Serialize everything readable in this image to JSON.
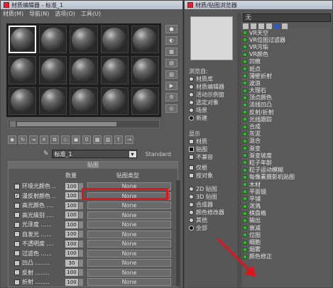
{
  "material_editor": {
    "title": "材质编辑器 - 标准_1",
    "menu": [
      "材质(M)",
      "导航(N)",
      "选项(O)",
      "工具(U)"
    ],
    "material_name": "标准_1",
    "material_type": "Standard",
    "maps_rollout": {
      "header": "贴图",
      "col_amount": "数量",
      "col_map_type": "贴图类型",
      "rows": [
        {
          "label": "环境光颜色 ..",
          "amount": "100",
          "map": "None",
          "checked": false
        },
        {
          "label": "漫反射颜色 ..",
          "amount": "100",
          "map": "None",
          "checked": true
        },
        {
          "label": "高光颜色 ....",
          "amount": "100",
          "map": "None",
          "checked": false
        },
        {
          "label": "高光级别 ....",
          "amount": "100",
          "map": "None",
          "checked": false
        },
        {
          "label": "光泽度 ......",
          "amount": "100",
          "map": "None",
          "checked": false
        },
        {
          "label": "自发光 ......",
          "amount": "100",
          "map": "None",
          "checked": false
        },
        {
          "label": "不透明度 ....",
          "amount": "100",
          "map": "None",
          "checked": false
        },
        {
          "label": "过滤色 ......",
          "amount": "100",
          "map": "None",
          "checked": false
        },
        {
          "label": "凹凸 ........",
          "amount": "30",
          "map": "None",
          "checked": false
        },
        {
          "label": "反射 ........",
          "amount": "100",
          "map": "None",
          "checked": false
        },
        {
          "label": "折射 ........",
          "amount": "100",
          "map": "None",
          "checked": false
        }
      ]
    }
  },
  "browser": {
    "title": "材质/贴图浏览器",
    "filter": "无",
    "browse_from_label": "浏览自:",
    "browse_from": [
      {
        "label": "材质库",
        "on": false
      },
      {
        "label": "材质编辑器",
        "on": false
      },
      {
        "label": "活动示例窗",
        "on": false
      },
      {
        "label": "选定对象",
        "on": false
      },
      {
        "label": "场景",
        "on": false
      },
      {
        "label": "新建",
        "on": true
      }
    ],
    "show_label": "显示",
    "show": [
      {
        "label": "材质",
        "on": false
      },
      {
        "label": "贴图",
        "on": true
      },
      {
        "label": "不兼容",
        "on": false
      }
    ],
    "extra": [
      {
        "label": "仅根",
        "on": false
      },
      {
        "label": "按对象",
        "on": false
      }
    ],
    "map_types": [
      {
        "label": "2D 贴图",
        "on": false
      },
      {
        "label": "3D 贴图",
        "on": false
      },
      {
        "label": "合成器",
        "on": false
      },
      {
        "label": "颜色修改器",
        "on": false
      },
      {
        "label": "其他",
        "on": false
      },
      {
        "label": "全部",
        "on": true
      }
    ],
    "items": [
      "VR天空",
      "VR位图过滤器",
      "VR污垢",
      "VR颜色",
      "凹痕",
      "斑点",
      "薄壁折射",
      "波浪",
      "大理石",
      "顶点颜色",
      "法线凹凸",
      "反射/折射",
      "光线跟踪",
      "合成",
      "灰泥",
      "混合",
      "渐变",
      "渐变坡度",
      "粒子年龄",
      "粒子运动模糊",
      "每像素摄影机贴图",
      "木材",
      "平面镜",
      "平铺",
      "泼溅",
      "棋盘格",
      "输出",
      "衰减",
      "位图",
      "细胞",
      "烟雾",
      "颜色修正"
    ]
  }
}
